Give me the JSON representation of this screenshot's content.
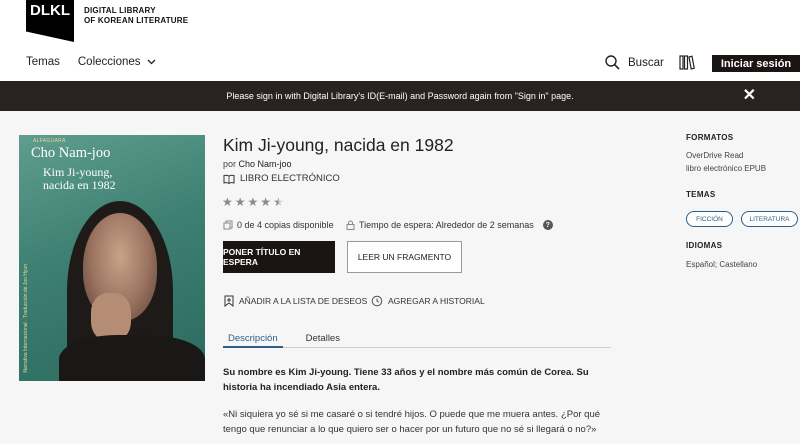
{
  "header": {
    "logo": "DLKL",
    "logo_line1": "DIGITAL LIBRARY",
    "logo_line2": "OF KOREAN LITERATURE",
    "nav_topics": "Temas",
    "nav_collections": "Colecciones",
    "search_label": "Buscar",
    "signin_label": "Iniciar sesión"
  },
  "banner": {
    "message": "Please sign in with Digital Library's ID(E-mail) and Password again from \"Sign in\" page."
  },
  "cover": {
    "publisher": "ALFAGUARA",
    "author": "Cho Nam-joo",
    "title_line1": "Kim Ji-young,",
    "title_line2": "nacida en 1982",
    "spine_text": "Narrativa Internacional · Traducción de Joo Hyun"
  },
  "book": {
    "title": "Kim Ji-young, nacida en 1982",
    "by_prefix": "por",
    "author": "Cho Nam-joo",
    "format": "LIBRO ELECTRÓNICO",
    "rating": 4.5,
    "availability": "0 de 4 copias disponible",
    "wait": "Tiempo de espera: Alrededor de 2 semanas",
    "hold_label": "PONER TÍTULO EN ESPERA",
    "sample_label": "LEER UN FRAGMENTO",
    "wishlist_label": "AÑADIR A LA LISTA DE DESEOS",
    "history_label": "AGREGAR A HISTORIAL",
    "tab_description": "Descripción",
    "tab_details": "Detalles",
    "desc_bold": "Su nombre es Kim Ji-young. Tiene 33 años y el nombre más común de Corea. Su historia ha incendiado Asia entera.",
    "desc_quote": "«Ni siquiera yo sé si me casaré o si tendré hijos. O puede que me muera antes. ¿Por qué tengo que renunciar a lo que quiero ser o hacer por un futuro que no sé si llegará o no?»"
  },
  "sidebar": {
    "formats_heading": "FORMATOS",
    "format_1": "OverDrive Read",
    "format_2": "libro electrónico EPUB",
    "topics_heading": "TEMAS",
    "topic_1": "FICCIÓN",
    "topic_2": "LITERATURA",
    "languages_heading": "IDIOMAS",
    "language_1": "Español; Castellano"
  },
  "colors": {
    "dark": "#1a1413",
    "banner": "#2a2221",
    "accent": "#2c5f8a",
    "background": "#f6f6f6"
  }
}
